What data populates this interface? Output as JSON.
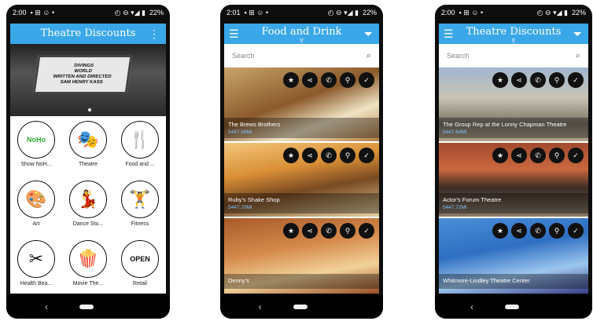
{
  "colors": {
    "accent": "#3aa7e8",
    "status_bar": "#0d0d0d",
    "distance": "#7fc4ff"
  },
  "phone1": {
    "status": {
      "time": "2:00",
      "battery": "22%"
    },
    "title": "Theatre Discounts",
    "menu_icon": "more-vert-icon",
    "marquee": [
      "DIVINGS",
      "WORLD",
      "WRITTEN AND DIRECTED",
      "SAM HENRY KASS"
    ],
    "categories": [
      {
        "label": "Show NoH...",
        "icon": "NoHo",
        "icon_name": "noho-logo-icon"
      },
      {
        "label": "Theatre",
        "icon": "🎭",
        "icon_name": "theatre-masks-icon"
      },
      {
        "label": "Food and ...",
        "icon": "🍴",
        "icon_name": "food-utensils-icon"
      },
      {
        "label": "Art",
        "icon": "🎨",
        "icon_name": "art-easel-icon"
      },
      {
        "label": "Dance Stu...",
        "icon": "💃",
        "icon_name": "dance-icon"
      },
      {
        "label": "Fitness",
        "icon": "🏋",
        "icon_name": "fitness-dumbbell-icon"
      },
      {
        "label": "Health Bea...",
        "icon": "✂",
        "icon_name": "health-beauty-icon"
      },
      {
        "label": "Movie The...",
        "icon": "🍿",
        "icon_name": "movie-popcorn-icon"
      },
      {
        "label": "Retail",
        "icon": "OPEN",
        "icon_name": "retail-open-sign-icon"
      }
    ]
  },
  "phone2": {
    "status": {
      "time": "2:01",
      "battery": "22%"
    },
    "title": "Food and Drink",
    "search_placeholder": "Search",
    "listings": [
      {
        "name": "The Brews Brothers",
        "distance": "5447.56Mi"
      },
      {
        "name": "Ruby's Shake Shop",
        "distance": "5447.70Mi"
      },
      {
        "name": "Denny's",
        "distance": ""
      }
    ]
  },
  "phone3": {
    "status": {
      "time": "2:00",
      "battery": "22%"
    },
    "title": "Theatre Discounts",
    "search_placeholder": "Search",
    "listings": [
      {
        "name": "The Group Rep at the Lonny Chapman Theatre",
        "distance": "5447.64Mi"
      },
      {
        "name": "Actor's Forum Theatre",
        "distance": "5447.72Mi"
      },
      {
        "name": "Whitmore-Lindley Theatre Center",
        "distance": ""
      }
    ]
  },
  "action_icons": [
    "deal-badge-icon",
    "share-icon",
    "phone-icon",
    "location-pin-icon",
    "check-icon"
  ]
}
